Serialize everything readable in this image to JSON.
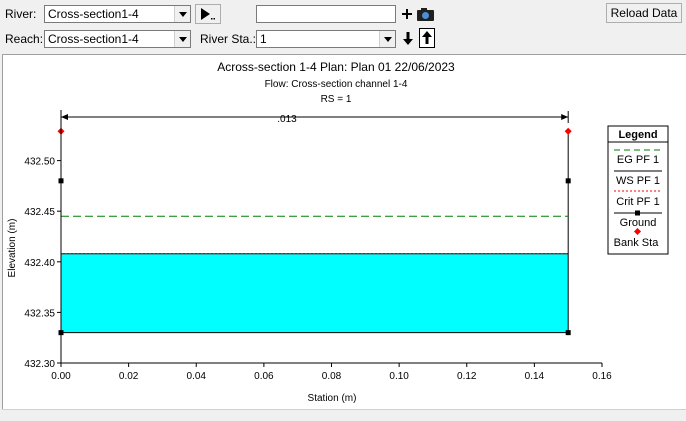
{
  "toolbar": {
    "river_label": "River:",
    "river_value": "Cross-section1-4",
    "reach_label": "Reach:",
    "reach_value": "Cross-section1-4",
    "river_sta_label": "River Sta.:",
    "river_sta_value": "1",
    "search_value": "",
    "reload_label": "Reload Data"
  },
  "plot": {
    "title": "Across-section 1-4      Plan: Plan 01      22/06/2023",
    "subtitle": "Flow: Cross-section channel 1-4",
    "rs_label": "RS = 1",
    "manning_n": ".013"
  },
  "legend": {
    "title": "Legend",
    "items": [
      "EG PF 1",
      "WS PF 1",
      "Crit PF 1",
      "Ground",
      "Bank Sta"
    ]
  },
  "colors": {
    "water": "#00ffff",
    "eg_line": "#008000",
    "crit_line": "#ff0000",
    "bank": "#ff0000",
    "ground": "#000000"
  },
  "chart_data": {
    "type": "line",
    "xlabel": "Station (m)",
    "ylabel": "Elevation (m)",
    "xlim": [
      0.0,
      0.16
    ],
    "ylim": [
      432.3,
      432.55
    ],
    "x_ticks": [
      "0.00",
      "0.02",
      "0.04",
      "0.06",
      "0.08",
      "0.10",
      "0.12",
      "0.14",
      "0.16"
    ],
    "y_ticks": [
      "432.30",
      "432.35",
      "432.40",
      "432.45",
      "432.50"
    ],
    "ground": {
      "x": [
        0.0,
        0.0,
        0.0,
        0.15,
        0.15,
        0.15
      ],
      "y": [
        432.529,
        432.48,
        432.33,
        432.33,
        432.48,
        432.529
      ]
    },
    "bank_stations": {
      "x": [
        0.0,
        0.15
      ],
      "y": [
        432.529,
        432.529
      ]
    },
    "eg_pf1": 432.445,
    "ws_pf1": 432.408,
    "crit_pf1": 432.408,
    "water_x": [
      0.0,
      0.15
    ]
  }
}
